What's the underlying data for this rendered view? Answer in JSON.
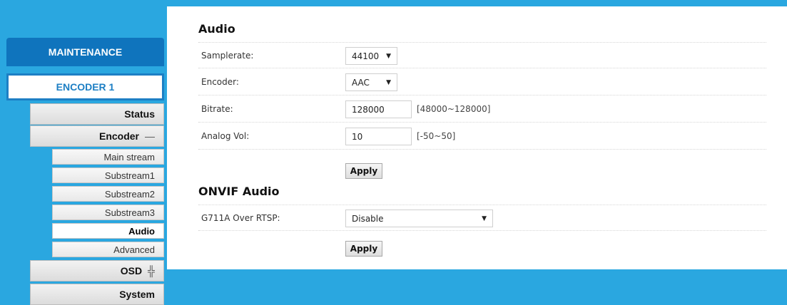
{
  "sidebar": {
    "maintenance": "MAINTENANCE",
    "encoder1": "ENCODER 1",
    "status": "Status",
    "encoder": {
      "label": "Encoder",
      "symbol": "—"
    },
    "sub_items": [
      "Main stream",
      "Substream1",
      "Substream2",
      "Substream3",
      "Audio",
      "Advanced"
    ],
    "osd": {
      "label": "OSD",
      "symbol": "╬"
    },
    "system": "System"
  },
  "audio": {
    "title": "Audio",
    "samplerate": {
      "label": "Samplerate:",
      "value": "44100"
    },
    "encoder": {
      "label": "Encoder:",
      "value": "AAC"
    },
    "bitrate": {
      "label": "Bitrate:",
      "value": "128000",
      "range": "[48000~128000]"
    },
    "analog_vol": {
      "label": "Analog Vol:",
      "value": "10",
      "range": "[-50~50]"
    },
    "apply": "Apply"
  },
  "onvif": {
    "title": "ONVIF Audio",
    "g711a": {
      "label": "G711A Over RTSP:",
      "value": "Disable"
    },
    "apply": "Apply"
  },
  "icons": {
    "dropdown": "▼"
  },
  "colors": {
    "accent": "#2aa7e0",
    "sidebar_primary": "#0f74bd",
    "selected_border": "#1d7fc4"
  }
}
